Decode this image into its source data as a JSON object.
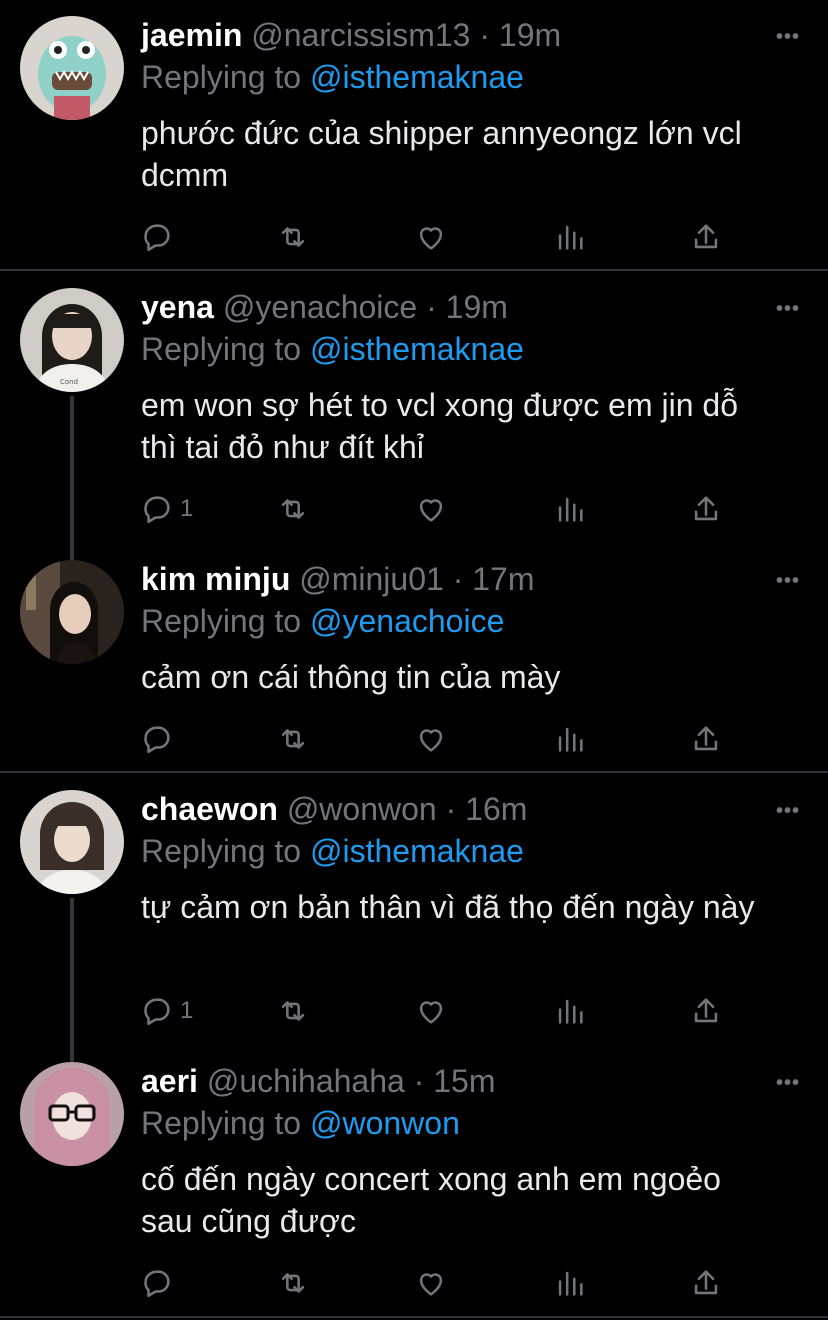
{
  "tweets": [
    {
      "name": "jaemin",
      "handle": "@narcissism13",
      "time": "19m",
      "replying_label": "Replying to",
      "replying_to": "@isthemaknae",
      "text": "phước đức của shipper annyeongz lớn vcl dcmm",
      "reply_count": "",
      "avatar_colors": [
        "#8fd1c9",
        "#6a4b3a"
      ]
    },
    {
      "name": "yena",
      "handle": "@yenachoice",
      "time": "19m",
      "replying_label": "Replying to",
      "replying_to": "@isthemaknae",
      "text": "em won sợ hét to vcl xong được em jin dỗ thì tai đỏ như đít khỉ",
      "reply_count": "1",
      "avatar_colors": [
        "#d8d6d2",
        "#2a2522"
      ]
    },
    {
      "name": "kim minju",
      "handle": "@minju01",
      "time": "17m",
      "replying_label": "Replying to",
      "replying_to": "@yenachoice",
      "text": "cảm ơn cái thông tin của mày",
      "reply_count": "",
      "avatar_colors": [
        "#5a4a3d",
        "#1e1915"
      ]
    },
    {
      "name": "chaewon",
      "handle": "@wonwon",
      "time": "16m",
      "replying_label": "Replying to",
      "replying_to": "@isthemaknae",
      "text": "tự cảm ơn bản thân vì đã thọ đến ngày này",
      "reply_count": "1",
      "avatar_colors": [
        "#d9d4cf",
        "#3a2e28"
      ]
    },
    {
      "name": "aeri",
      "handle": "@uchihahaha",
      "time": "15m",
      "replying_label": "Replying to",
      "replying_to": "@wonwon",
      "text": "cố đến ngày concert xong anh em ngoẻo sau cũng được",
      "reply_count": "",
      "avatar_colors": [
        "#c9a2b0",
        "#6e4652"
      ]
    }
  ],
  "colors": {
    "background": "#000000",
    "muted": "#71767b",
    "accent": "#1d9bf0",
    "divider": "#2f3336",
    "thread_line": "#333639"
  },
  "icons": [
    "reply-icon",
    "retweet-icon",
    "like-icon",
    "analytics-icon",
    "share-icon",
    "more-icon"
  ]
}
